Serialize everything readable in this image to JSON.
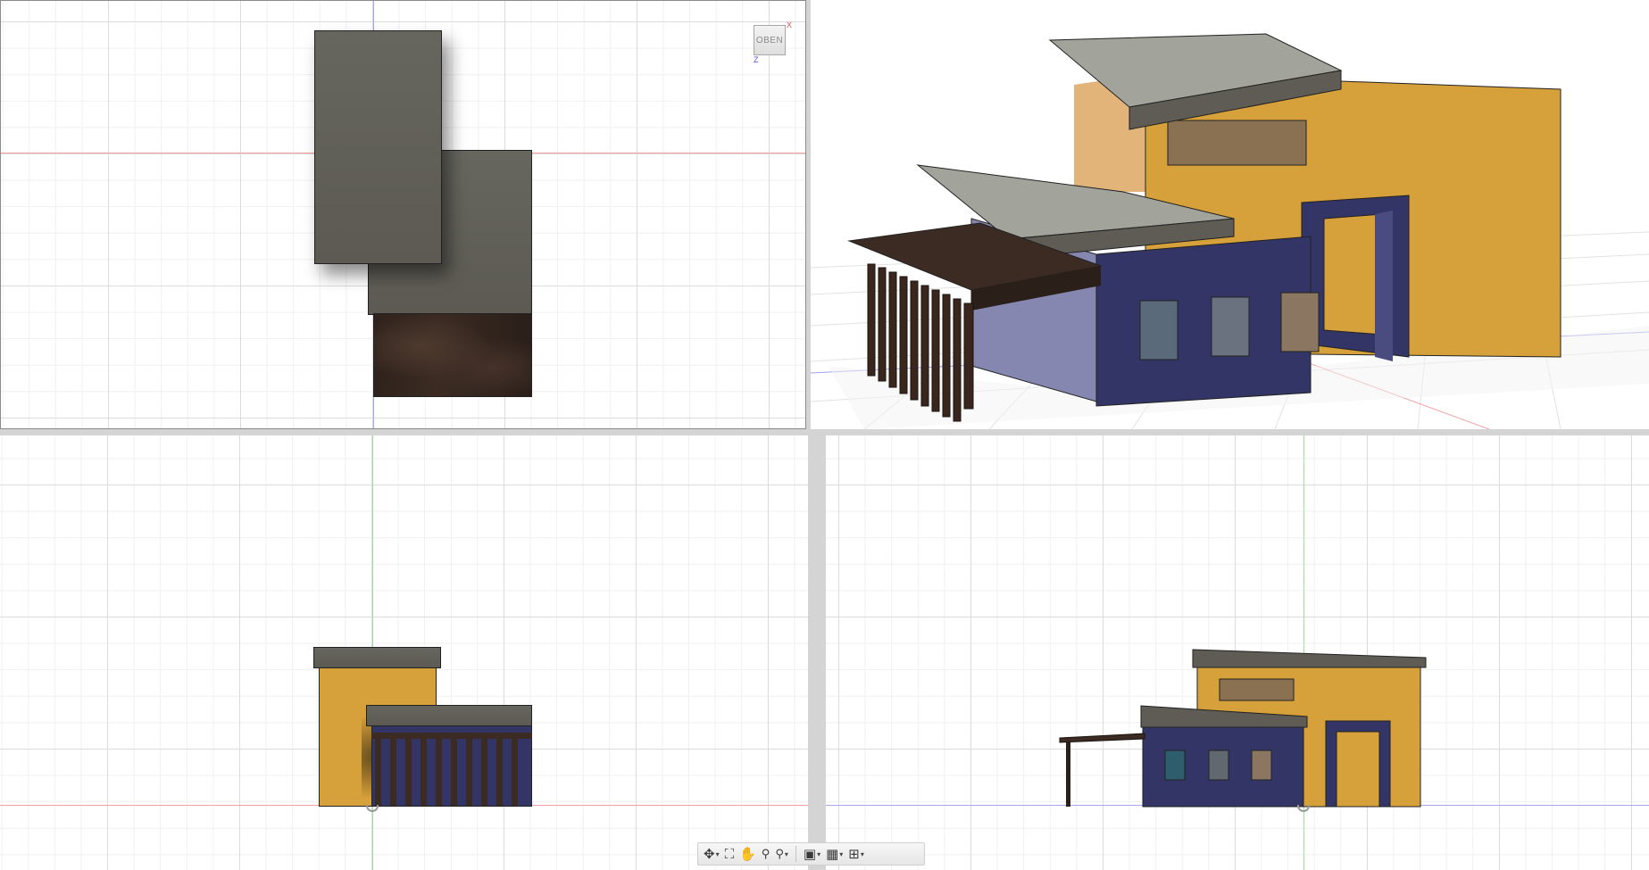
{
  "viewports": {
    "top": {
      "viewcube_label": "OBEN",
      "axis_x": "X",
      "axis_z": "Z"
    },
    "perspective": {},
    "front": {},
    "right": {}
  },
  "colors": {
    "roof": "#5e5c54",
    "wall_amber": "#d6a03a",
    "wall_navy": "#333566",
    "wood": "#33251e",
    "axis_red": "#f08080",
    "axis_green": "#8fdc8f",
    "axis_blue": "#8f8ff0"
  },
  "toolbar": {
    "buttons": [
      {
        "name": "orbit",
        "icon": "orbit-icon",
        "has_menu": true
      },
      {
        "name": "look-at",
        "icon": "look-at-icon",
        "has_menu": false
      },
      {
        "name": "pan",
        "icon": "hand-icon",
        "has_menu": false
      },
      {
        "name": "zoom",
        "icon": "zoom-icon",
        "has_menu": false
      },
      {
        "name": "fit",
        "icon": "zoom-window-icon",
        "has_menu": true
      },
      {
        "name": "display-settings",
        "icon": "monitor-icon",
        "has_menu": true
      },
      {
        "name": "grid-settings",
        "icon": "grid-icon",
        "has_menu": true
      },
      {
        "name": "viewports",
        "icon": "viewports-icon",
        "has_menu": true
      }
    ],
    "glyphs": {
      "orbit": "✥",
      "look_at": "⛶",
      "pan": "✋",
      "zoom": "🔍",
      "fit": "⚲",
      "display": "▣",
      "grid": "▦",
      "viewports": "⊞",
      "caret": "▾"
    }
  }
}
